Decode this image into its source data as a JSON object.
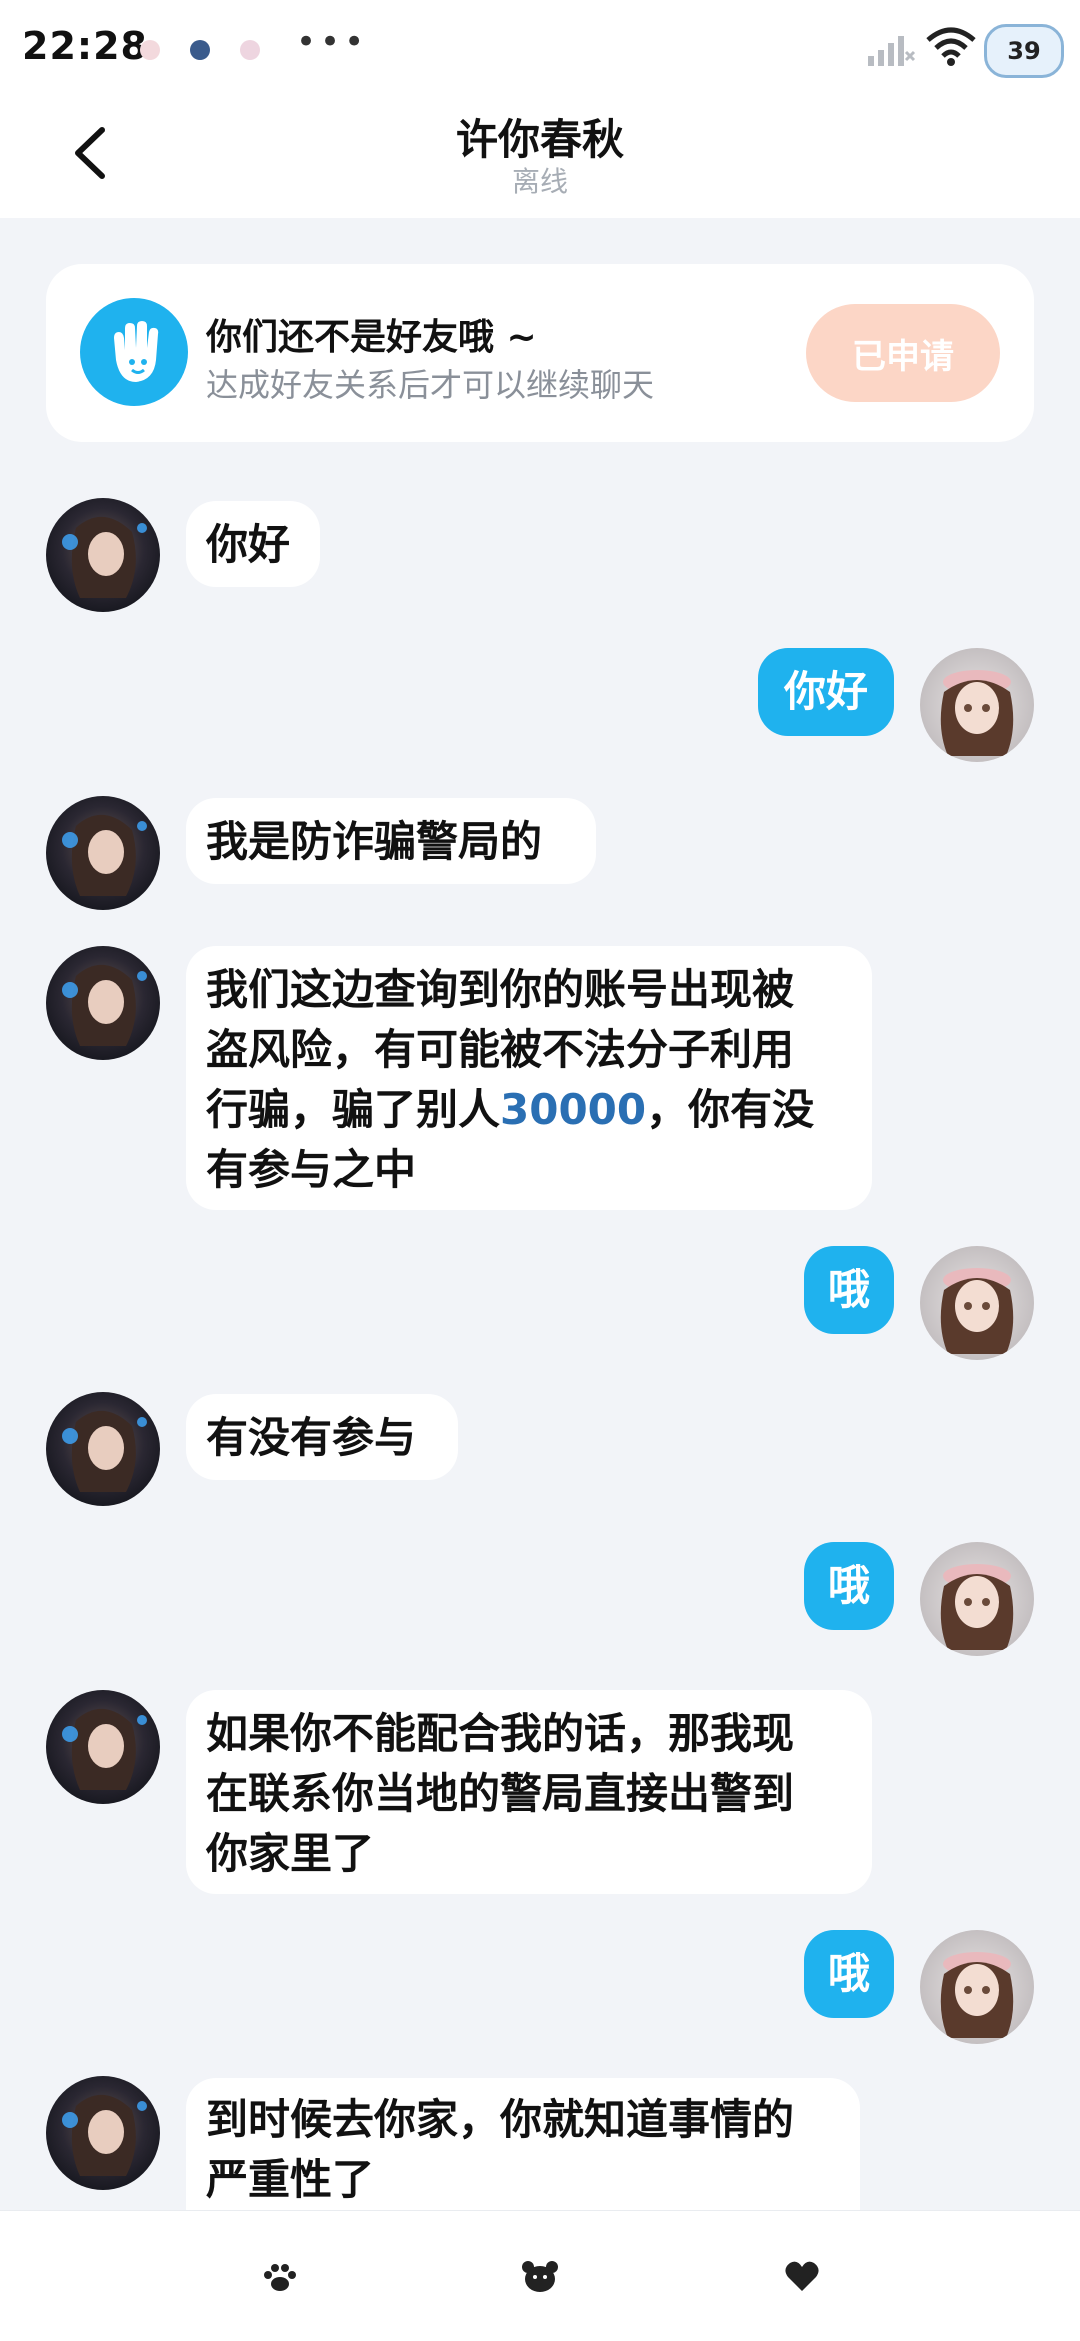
{
  "status_bar": {
    "time": "22:28",
    "battery": "39"
  },
  "header": {
    "title": "许你春秋",
    "status": "离线"
  },
  "friend_banner": {
    "title": "你们还不是好友哦 ~",
    "subtitle": "达成好友关系后才可以继续聊天",
    "button": "已申请"
  },
  "messages": [
    {
      "side": "in",
      "text": "你好"
    },
    {
      "side": "out",
      "text": "你好"
    },
    {
      "side": "in",
      "text": "我是防诈骗警局的"
    },
    {
      "side": "in",
      "lines": [
        "我们这边查询到你的账号出现被",
        "盗风险，有可能被不法分子利用",
        "行骗，骗了别人",
        "，你有没",
        "有参与之中"
      ],
      "highlight": "30000"
    },
    {
      "side": "out",
      "text": "哦"
    },
    {
      "side": "in",
      "text": "有没有参与"
    },
    {
      "side": "out",
      "text": "哦"
    },
    {
      "side": "in",
      "lines": [
        "如果你不能配合我的话，那我现",
        "在联系你当地的警局直接出警到",
        "你家里了"
      ]
    },
    {
      "side": "out",
      "text": "哦"
    },
    {
      "side": "in",
      "lines": [
        "到时候去你家，你就知道事情的",
        "严重性了"
      ]
    }
  ],
  "bottom_bar": {
    "icons": [
      "paw-icon",
      "bear-icon",
      "heart-icon"
    ]
  },
  "colors": {
    "accent": "#1fb2ee",
    "applied_button": "#fcd6c6",
    "background": "#f2f4f8",
    "highlight_number": "#2a6fb3"
  }
}
